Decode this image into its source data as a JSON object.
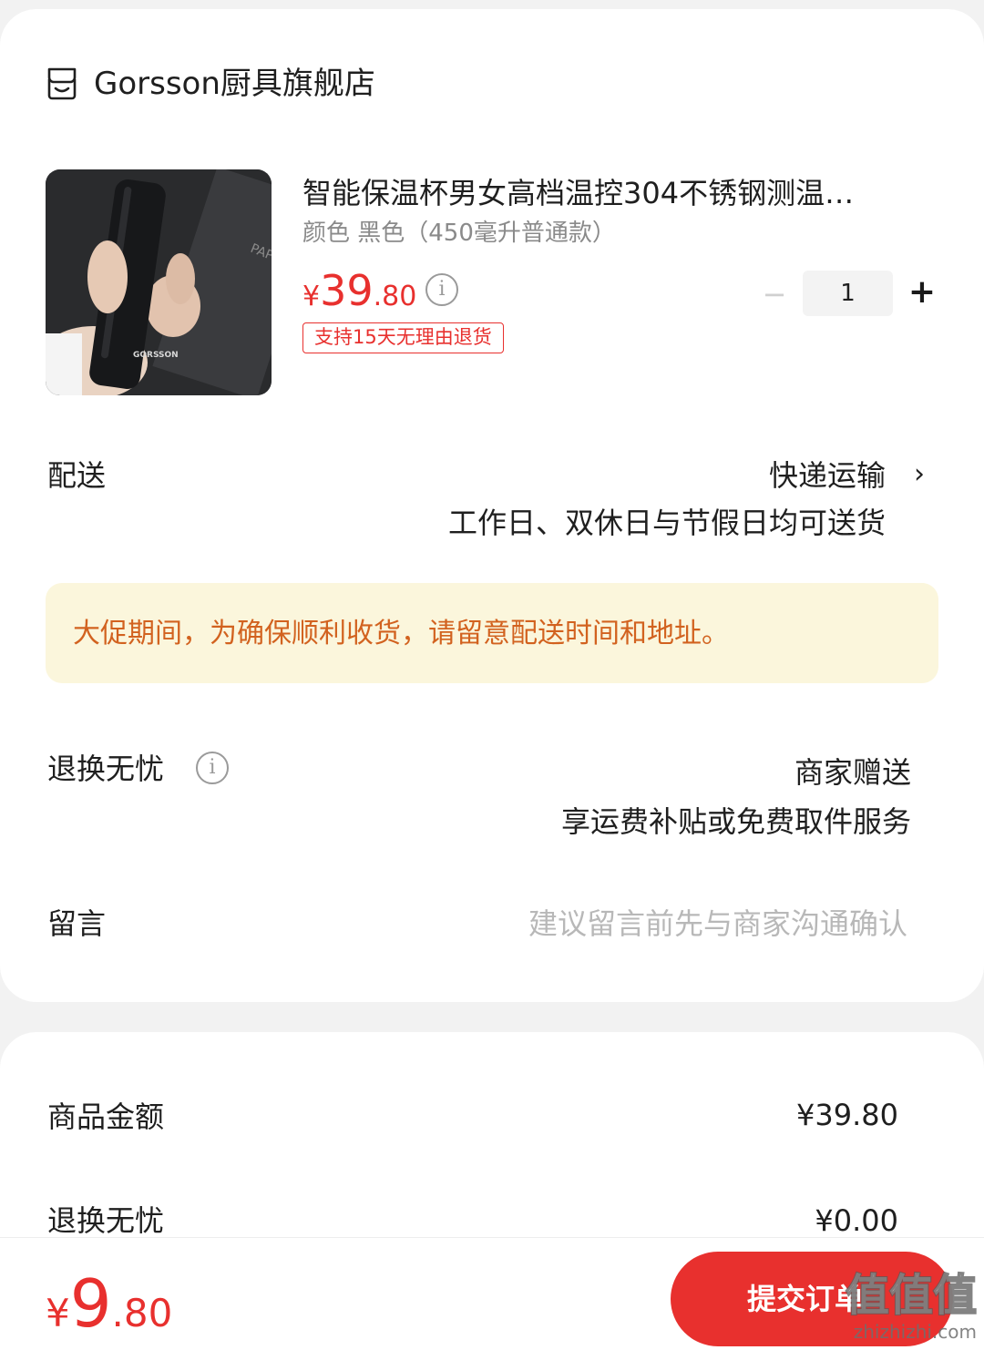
{
  "shop": {
    "icon": "shop-icon",
    "name": "Gorsson厨具旗舰店"
  },
  "product": {
    "title": "智能保温杯男女高档温控304不锈钢测温…",
    "spec": "颜色 黑色（450毫升普通款）",
    "price": {
      "currency": "¥",
      "integer": "39",
      "decimal": ".80"
    },
    "refund_badge": "支持15天无理由退货",
    "quantity": {
      "minus": "−",
      "value": "1",
      "plus": "+"
    },
    "image_text": {
      "tag": "GORSSON",
      "box_text": "PAP"
    }
  },
  "delivery": {
    "label": "配送",
    "method": "快递运输",
    "note": "工作日、双休日与节假日均可送货"
  },
  "notice": {
    "text": "大促期间，为确保顺利收货，请留意配送时间和地址。"
  },
  "return_service": {
    "label": "退换无忧",
    "value": "商家赠送",
    "desc": "享运费补贴或免费取件服务"
  },
  "message": {
    "label": "留言",
    "placeholder": "建议留言前先与商家沟通确认"
  },
  "summary": {
    "goods_label": "商品金额",
    "goods_value": "¥39.80",
    "return_fee_label": "退换无忧",
    "return_fee_value": "¥0.00"
  },
  "bottom": {
    "total": {
      "currency": "¥",
      "integer": "9",
      "decimal": ".80"
    },
    "submit_label": "提交订单"
  },
  "watermark": {
    "logo": "值值值",
    "site": "zhizhizhi.com"
  },
  "colors": {
    "accent": "#e8302e",
    "notice_bg": "#fbf6dc",
    "notice_text": "#d2621f"
  }
}
